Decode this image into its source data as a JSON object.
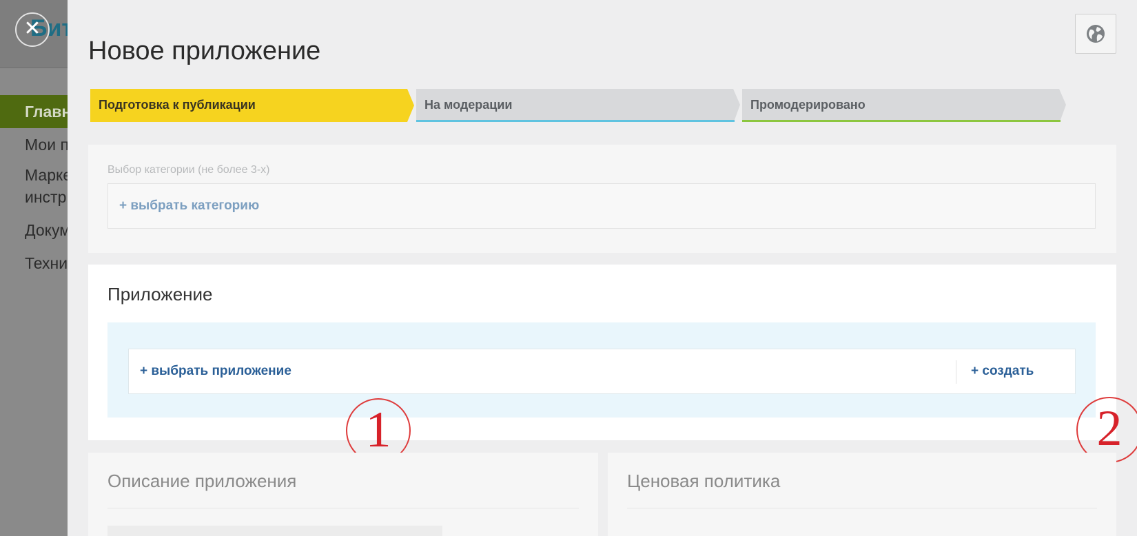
{
  "background": {
    "logo_text": "Бит",
    "nav_items": [
      "Главн",
      "Мои п",
      "Марке инстр",
      "Докум",
      "Техни"
    ]
  },
  "close_icon_glyph": "✕",
  "panel": {
    "title": "Новое приложение"
  },
  "steps": [
    {
      "label": "Подготовка к публикации",
      "state": "active",
      "color": "#f6d31f"
    },
    {
      "label": "На модерации",
      "state": "pending",
      "underline": "#5fc3e0"
    },
    {
      "label": "Промодерировано",
      "state": "pending",
      "underline": "#8cc63f"
    }
  ],
  "category": {
    "caption": "Выбор категории (не более 3-х)",
    "add_label": "+ выбрать категорию"
  },
  "application": {
    "heading": "Приложение",
    "choose_label": "+ выбрать приложение",
    "create_label": "+ создать"
  },
  "annotations": {
    "marker1": "1",
    "marker2": "2"
  },
  "sections": {
    "description": "Описание приложения",
    "pricing": "Ценовая политика"
  },
  "icons": {
    "globe": "globe-icon",
    "close": "close-icon"
  }
}
